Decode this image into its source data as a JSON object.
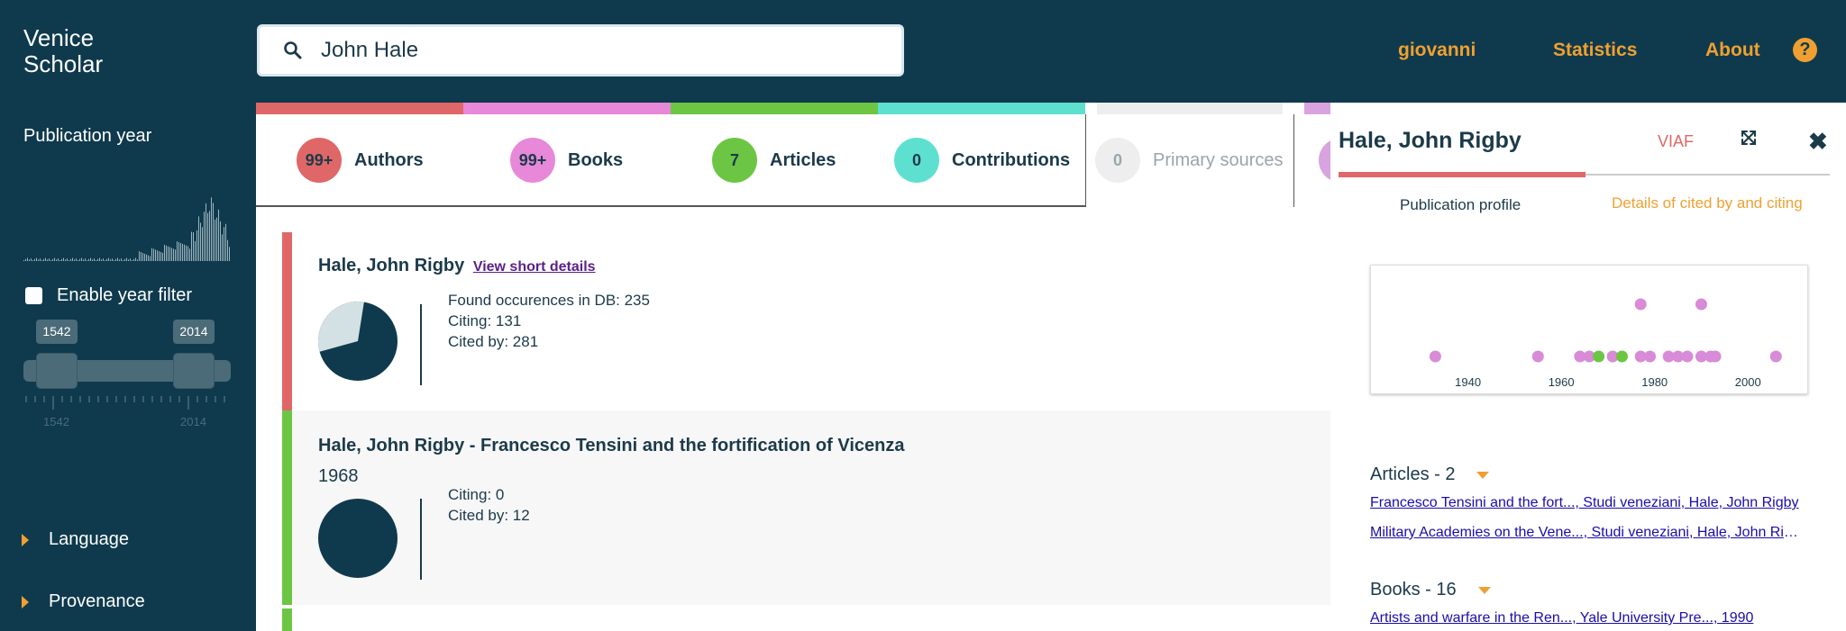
{
  "app": {
    "logo_line1": "Venice",
    "logo_line2": "Scholar"
  },
  "search": {
    "value": "John Hale",
    "icon": "search-icon"
  },
  "topnav": {
    "user": "giovanni",
    "statistics": "Statistics",
    "about": "About",
    "help_glyph": "?"
  },
  "sidebar": {
    "publication_year_title": "Publication year",
    "year_filter_label": "Enable year filter",
    "slider": {
      "min_label": "1542",
      "max_label": "2014",
      "min_tick": "1542",
      "max_tick": "2014"
    },
    "items": [
      {
        "label": "Language"
      },
      {
        "label": "Provenance"
      }
    ]
  },
  "tabs": [
    {
      "count": "99+",
      "label": "Authors",
      "color": "#e06767"
    },
    {
      "count": "99+",
      "label": "Books",
      "color": "#e888d8"
    },
    {
      "count": "7",
      "label": "Articles",
      "color": "#6cc644"
    },
    {
      "count": "0",
      "label": "Contributions",
      "color": "#5ee0d0"
    },
    {
      "count": "0",
      "label": "Primary sources",
      "color": "#eeeeee"
    }
  ],
  "results": [
    {
      "title": "Hale, John Rigby",
      "link": "View short details",
      "stats": [
        "Found occurences in DB: 235",
        "Citing: 131",
        "Cited by: 281"
      ],
      "citing_fraction": 0.318,
      "accent": "#e06767"
    },
    {
      "title": "Hale, John Rigby - Francesco Tensini and the fortification of Vicenza",
      "year": "1968",
      "stats": [
        "Citing: 0",
        "Cited by: 12"
      ],
      "citing_fraction": 0,
      "accent": "#6cc644"
    }
  ],
  "panel": {
    "title": "Hale, John Rigby",
    "viaf": "VIAF",
    "close_glyph": "✖",
    "tab_profile": "Publication profile",
    "tab_details": "Details of cited by and citing",
    "articles_header": "Articles - 2",
    "articles": [
      "Francesco Tensini and the fort..., Studi veneziani, Hale, John Rigby",
      "Military Academies on the Vene..., Studi veneziani, Hale, John Rigby"
    ],
    "books_header": "Books - 16",
    "books": [
      "Artists and warfare in the Ren..., Yale University Pre..., 1990"
    ]
  },
  "chart_data": {
    "type": "scatter",
    "xlim": [
      1925,
      2010
    ],
    "x_ticks": [
      "1940",
      "1960",
      "1980",
      "2000"
    ],
    "colors": {
      "book": "#d88bd6",
      "article": "#6cc644"
    },
    "points": [
      {
        "x": 1933,
        "level": 1,
        "kind": "book"
      },
      {
        "x": 1955,
        "level": 1,
        "kind": "book"
      },
      {
        "x": 1964,
        "level": 1,
        "kind": "book"
      },
      {
        "x": 1966,
        "level": 1,
        "kind": "book"
      },
      {
        "x": 1968,
        "level": 1,
        "kind": "article"
      },
      {
        "x": 1971,
        "level": 1,
        "kind": "book"
      },
      {
        "x": 1973,
        "level": 1,
        "kind": "article"
      },
      {
        "x": 1977,
        "level": 1,
        "kind": "book"
      },
      {
        "x": 1977,
        "level": 2,
        "kind": "book"
      },
      {
        "x": 1979,
        "level": 1,
        "kind": "book"
      },
      {
        "x": 1983,
        "level": 1,
        "kind": "book"
      },
      {
        "x": 1985,
        "level": 1,
        "kind": "book"
      },
      {
        "x": 1987,
        "level": 1,
        "kind": "book"
      },
      {
        "x": 1990,
        "level": 1,
        "kind": "book"
      },
      {
        "x": 1990,
        "level": 2,
        "kind": "book"
      },
      {
        "x": 1992,
        "level": 1,
        "kind": "book"
      },
      {
        "x": 1993,
        "level": 1,
        "kind": "book"
      },
      {
        "x": 2006,
        "level": 1,
        "kind": "book"
      }
    ]
  }
}
